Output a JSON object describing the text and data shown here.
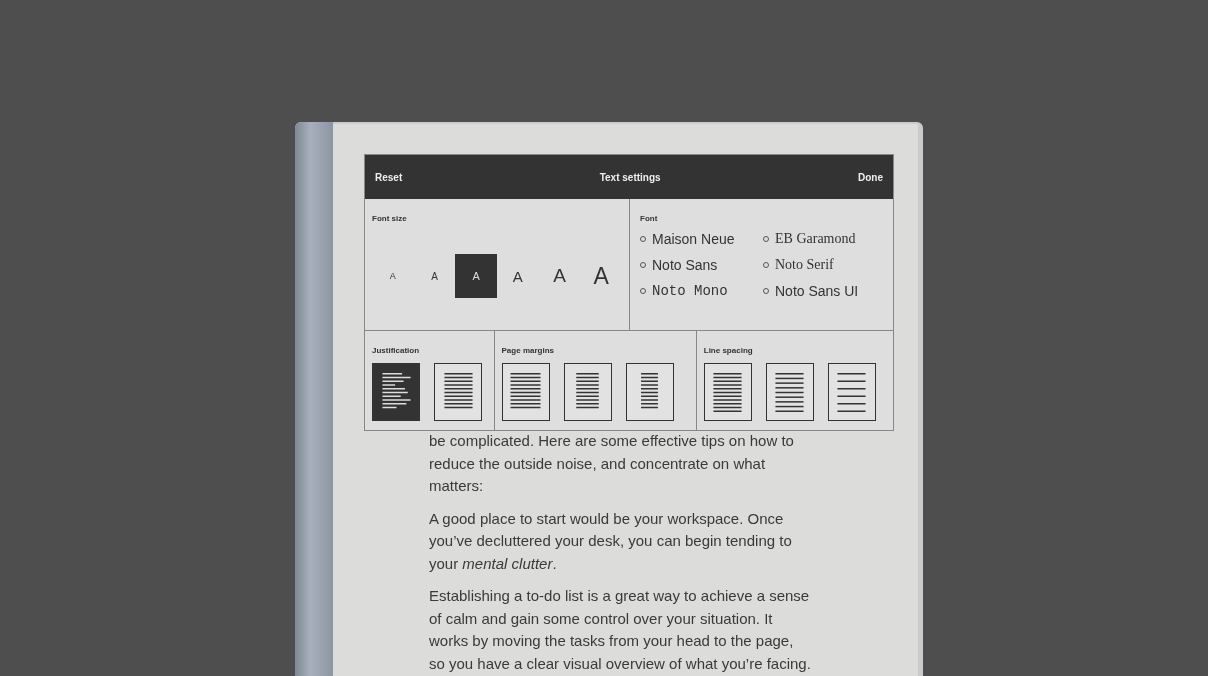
{
  "header": {
    "reset": "Reset",
    "title": "Text settings",
    "done": "Done"
  },
  "font_size": {
    "label": "Font size",
    "options": [
      {
        "label": "A",
        "selected": false
      },
      {
        "label": "A",
        "selected": false
      },
      {
        "label": "A",
        "selected": true
      },
      {
        "label": "A",
        "selected": false
      },
      {
        "label": "A",
        "selected": false
      },
      {
        "label": "A",
        "selected": false
      }
    ]
  },
  "font": {
    "label": "Font",
    "options": [
      {
        "name": "Maison Neue",
        "kind": "sans"
      },
      {
        "name": "EB Garamond",
        "kind": "serif"
      },
      {
        "name": "Noto Sans",
        "kind": "sans"
      },
      {
        "name": "Noto Serif",
        "kind": "serif"
      },
      {
        "name": "Noto Mono",
        "kind": "mono"
      },
      {
        "name": "Noto Sans UI",
        "kind": "sans"
      }
    ]
  },
  "justification": {
    "label": "Justification",
    "options": [
      {
        "kind": "ragged",
        "selected": true
      },
      {
        "kind": "justified",
        "selected": false
      }
    ]
  },
  "page_margins": {
    "label": "Page margins",
    "options": [
      {
        "kind": "small",
        "selected": false
      },
      {
        "kind": "medium",
        "selected": false
      },
      {
        "kind": "large",
        "selected": false
      }
    ]
  },
  "line_spacing": {
    "label": "Line spacing",
    "options": [
      {
        "kind": "small",
        "selected": false
      },
      {
        "kind": "medium",
        "selected": false
      },
      {
        "kind": "large",
        "selected": false
      }
    ]
  },
  "body": [
    "be complicated. Here are some effective tips on how to reduce the outside noise, and concentrate on what matters:",
    "A good place to start would be your workspace. Once you’ve decluttered your desk, you can begin tending to your *mental clutter*.",
    "Establishing a to-do list is a great way to achieve a sense of calm and gain some control over your situation. It works by moving the tasks from your head to the page, so you have a clear visual overview of what you’re facing."
  ]
}
